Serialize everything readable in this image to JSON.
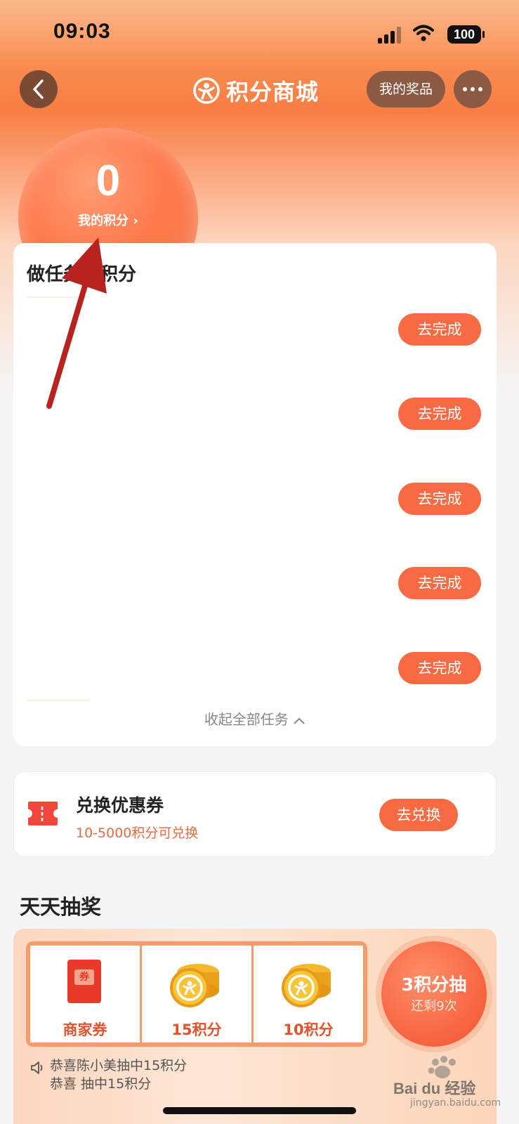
{
  "status_bar": {
    "time": "09:03",
    "battery": "100"
  },
  "nav": {
    "title": "积分商城",
    "my_prizes_label": "我的奖品"
  },
  "points": {
    "value": "0",
    "label": "我的积分 ›"
  },
  "tasks": {
    "title": "做任务赚积分",
    "items": [
      {
        "button_label": "去完成"
      },
      {
        "button_label": "去完成"
      },
      {
        "button_label": "去完成"
      },
      {
        "button_label": "去完成"
      },
      {
        "button_label": "去完成"
      }
    ],
    "collapse_label": "收起全部任务"
  },
  "exchange": {
    "title": "兑换优惠券",
    "subtitle": "10-5000积分可兑换",
    "button_label": "去兑换"
  },
  "lottery": {
    "title": "天天抽奖",
    "prizes": [
      {
        "label": "商家券",
        "icon_text": "券"
      },
      {
        "label": "15积分"
      },
      {
        "label": "10积分"
      }
    ],
    "draw_label": "3积分抽",
    "draw_remaining": "还剩9次",
    "ticker": [
      "恭喜陈小美抽中15积分",
      "恭喜        抽中15积分"
    ]
  },
  "watermark": {
    "brand": "Bai du 经验",
    "url": "jingyan.baidu.com"
  },
  "colors": {
    "accent": "#f76a43",
    "hero_top": "#f88a4e",
    "nav_button": "#8c5a42",
    "annotation_arrow": "#b8231f"
  },
  "icons": {
    "back": "chevron-left-icon",
    "logo": "points-mall-logo-icon",
    "more": "more-dots-icon",
    "ticket": "ticket-icon",
    "coin": "coin-icon",
    "speaker": "speaker-icon"
  }
}
